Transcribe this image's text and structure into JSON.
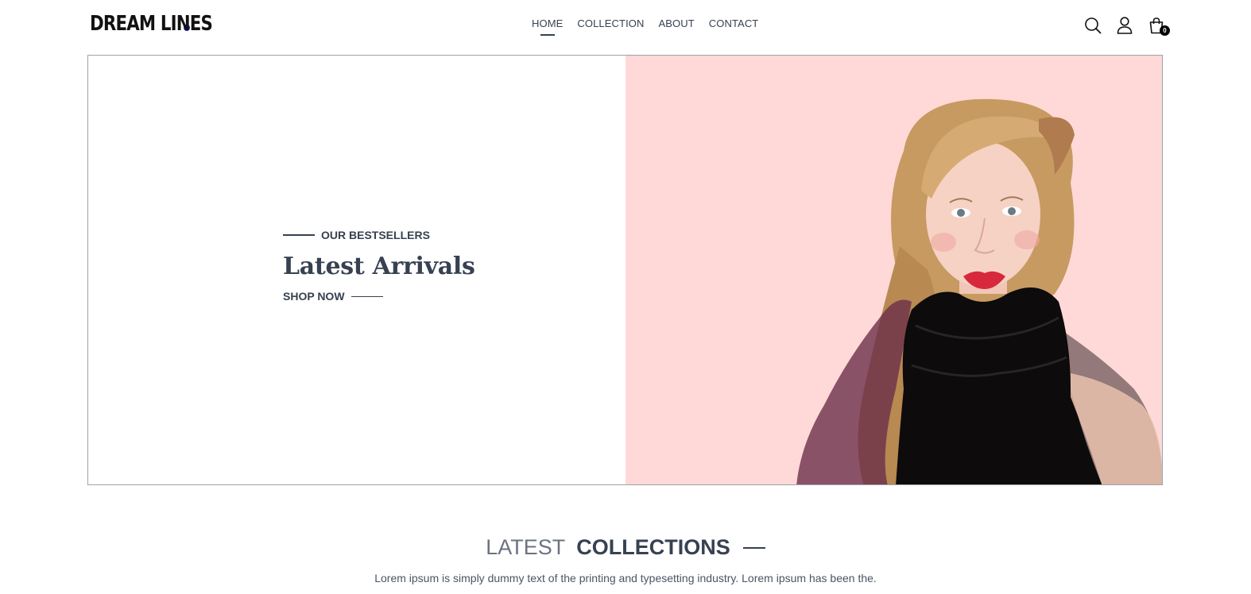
{
  "brand": {
    "name": "DREAM LINES",
    "dot_color": "#1d1dd6"
  },
  "nav": {
    "items": [
      {
        "label": "HOME",
        "active": true
      },
      {
        "label": "COLLECTION",
        "active": false
      },
      {
        "label": "ABOUT",
        "active": false
      },
      {
        "label": "CONTACT",
        "active": false
      }
    ]
  },
  "header_icons": {
    "search": "search-icon",
    "profile": "user-icon",
    "cart": "shopping-bag-icon",
    "cart_count": "0"
  },
  "hero": {
    "eyebrow": "OUR BESTSELLERS",
    "title": "Latest Arrivals",
    "cta": "SHOP NOW",
    "image_bg": "#ffd9d7"
  },
  "collections": {
    "title_light": "LATEST",
    "title_bold": "COLLECTIONS",
    "subtitle": "Lorem ipsum is simply dummy text of the printing and typesetting industry. Lorem ipsum has been the."
  }
}
